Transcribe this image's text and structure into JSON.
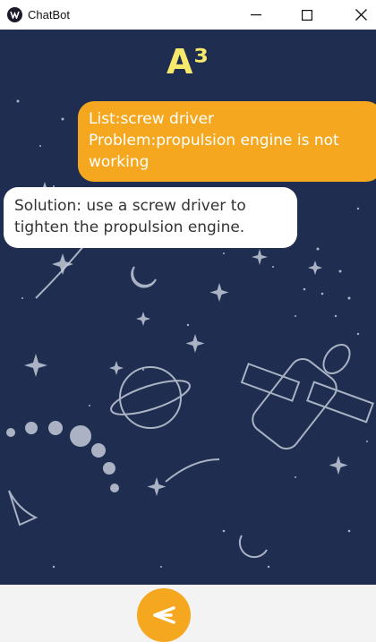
{
  "window": {
    "title": "ChatBot"
  },
  "header": {
    "title": "A³"
  },
  "messages": {
    "user": {
      "line1": "List:screw driver",
      "line2": "Problem:propulsion engine is not",
      "line3": "working"
    },
    "bot": {
      "text": " Solution: use a screw driver to tighten the propulsion engine."
    }
  },
  "colors": {
    "background": "#1e2d50",
    "accent": "#f5a81f",
    "title": "#f7e96b"
  },
  "icons": {
    "app": "chatbot-logo-icon",
    "send": "send-arrow-icon"
  }
}
